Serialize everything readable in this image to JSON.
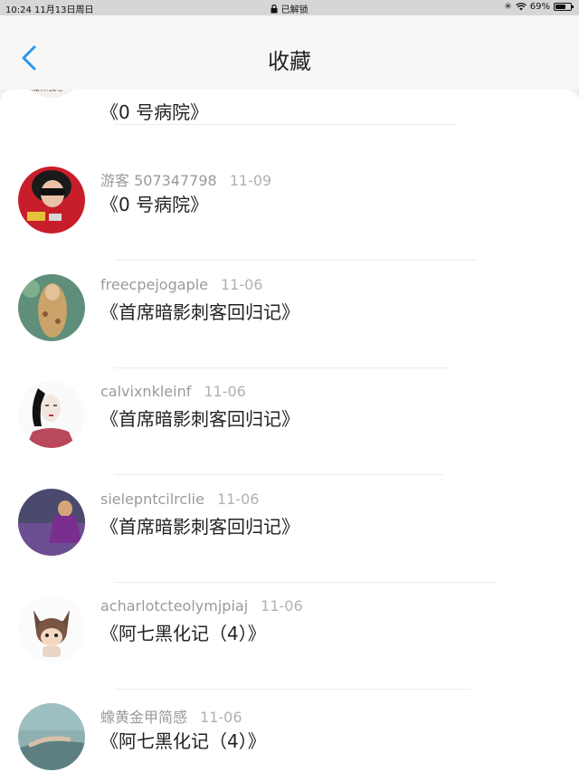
{
  "status": {
    "time_date": "10:24  11月13日周日",
    "lock_text": "已解锁",
    "battery": "69%",
    "battery_level": 0.69
  },
  "nav": {
    "title": "收藏",
    "back_icon": "chevron-left-icon"
  },
  "accent": "#2b95e8",
  "items": [
    {
      "user": "",
      "date": "",
      "title": "《0 号病院》"
    },
    {
      "user": "游客 507347798",
      "date": "11-09",
      "title": "《0 号病院》"
    },
    {
      "user": "freecpejogaple",
      "date": "11-06",
      "title": "《首席暗影刺客回归记》"
    },
    {
      "user": "calvixnkleinf",
      "date": "11-06",
      "title": "《首席暗影刺客回归记》"
    },
    {
      "user": "sielepntcilrclie",
      "date": "11-06",
      "title": "《首席暗影刺客回归记》"
    },
    {
      "user": "acharlotcteolymjpiaj",
      "date": "11-06",
      "title": "《阿七黑化记（4）》"
    },
    {
      "user": "蟓黄金甲简感",
      "date": "11-06",
      "title": "《阿七黑化记（4）》"
    }
  ]
}
